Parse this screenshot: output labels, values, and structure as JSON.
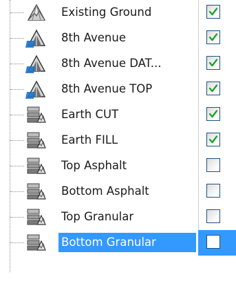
{
  "tree": {
    "items": [
      {
        "label": "Existing Ground",
        "checked": true,
        "icon": "surface-icon",
        "selected": false
      },
      {
        "label": "8th Avenue",
        "checked": true,
        "icon": "corridor-surface-icon",
        "selected": false
      },
      {
        "label": "8th Avenue DAT...",
        "checked": true,
        "icon": "corridor-surface-icon",
        "selected": false
      },
      {
        "label": "8th Avenue TOP",
        "checked": true,
        "icon": "corridor-surface-icon",
        "selected": false
      },
      {
        "label": "Earth CUT",
        "checked": true,
        "icon": "shape-surface-icon",
        "selected": false
      },
      {
        "label": "Earth FILL",
        "checked": true,
        "icon": "shape-surface-icon",
        "selected": false
      },
      {
        "label": "Top Asphalt",
        "checked": false,
        "icon": "shape-surface-icon",
        "selected": false
      },
      {
        "label": "Bottom Asphalt",
        "checked": false,
        "icon": "shape-surface-icon",
        "selected": false
      },
      {
        "label": "Top Granular",
        "checked": false,
        "icon": "shape-surface-icon",
        "selected": false
      },
      {
        "label": "Bottom Granular",
        "checked": false,
        "icon": "shape-surface-icon",
        "selected": true
      }
    ]
  },
  "colors": {
    "selection": "#3399ff",
    "checkmark": "#1aa32a",
    "checkbox_border": "#1c5180"
  }
}
